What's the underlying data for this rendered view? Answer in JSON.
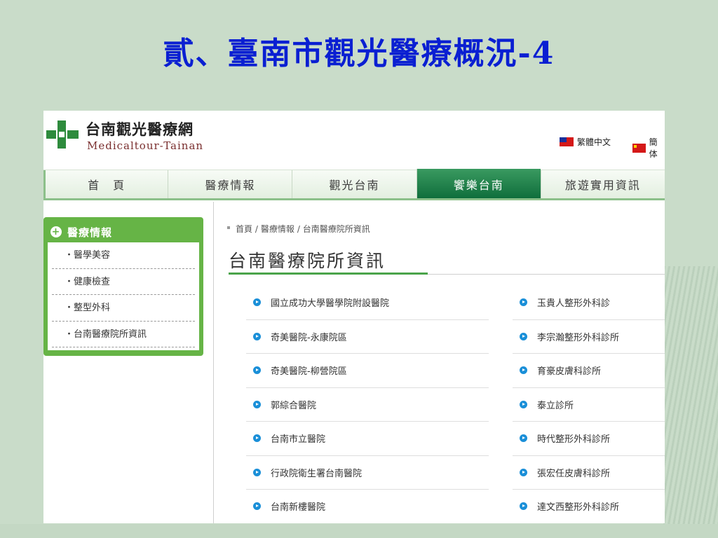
{
  "slide": {
    "title": "貳、臺南市觀光醫療概況-4"
  },
  "site": {
    "logo_title": "台南觀光醫療網",
    "logo_subtitle": "Medicaltour-Tainan",
    "lang_traditional": "繁體中文",
    "lang_simplified": "簡体"
  },
  "nav": {
    "items": [
      "首　頁",
      "醫療情報",
      "觀光台南",
      "饗樂台南",
      "旅遊實用資訊"
    ],
    "active_index": 3
  },
  "sidebar": {
    "heading": "醫療情報",
    "items": [
      "・醫學美容",
      "・健康檢查",
      "・整型外科",
      "・台南醫療院所資訊"
    ]
  },
  "breadcrumb": {
    "items": [
      "首頁 /",
      "醫療情報",
      "/ 台南醫療院所資訊"
    ]
  },
  "page": {
    "title": "台南醫療院所資訊"
  },
  "hospitals_left": [
    "國立成功大學醫學院附設醫院",
    "奇美醫院-永康院區",
    "奇美醫院-柳營院區",
    "郭綜合醫院",
    "台南市立醫院",
    "行政院衛生署台南醫院",
    "台南新樓醫院"
  ],
  "hospitals_right": [
    "玉貴人整形外科診",
    "李宗瀚整形外科診所",
    "育豪皮膚科診所",
    "泰立診所",
    "時代整形外科診所",
    "張宏任皮膚科診所",
    "達文西整形外科診所"
  ],
  "colors": {
    "slide_background": "#c9dcc9",
    "title": "#0a1fd2",
    "nav_active": "#0f6e3c",
    "sidebar": "#66b446",
    "bullet": "#1a8fd8"
  }
}
